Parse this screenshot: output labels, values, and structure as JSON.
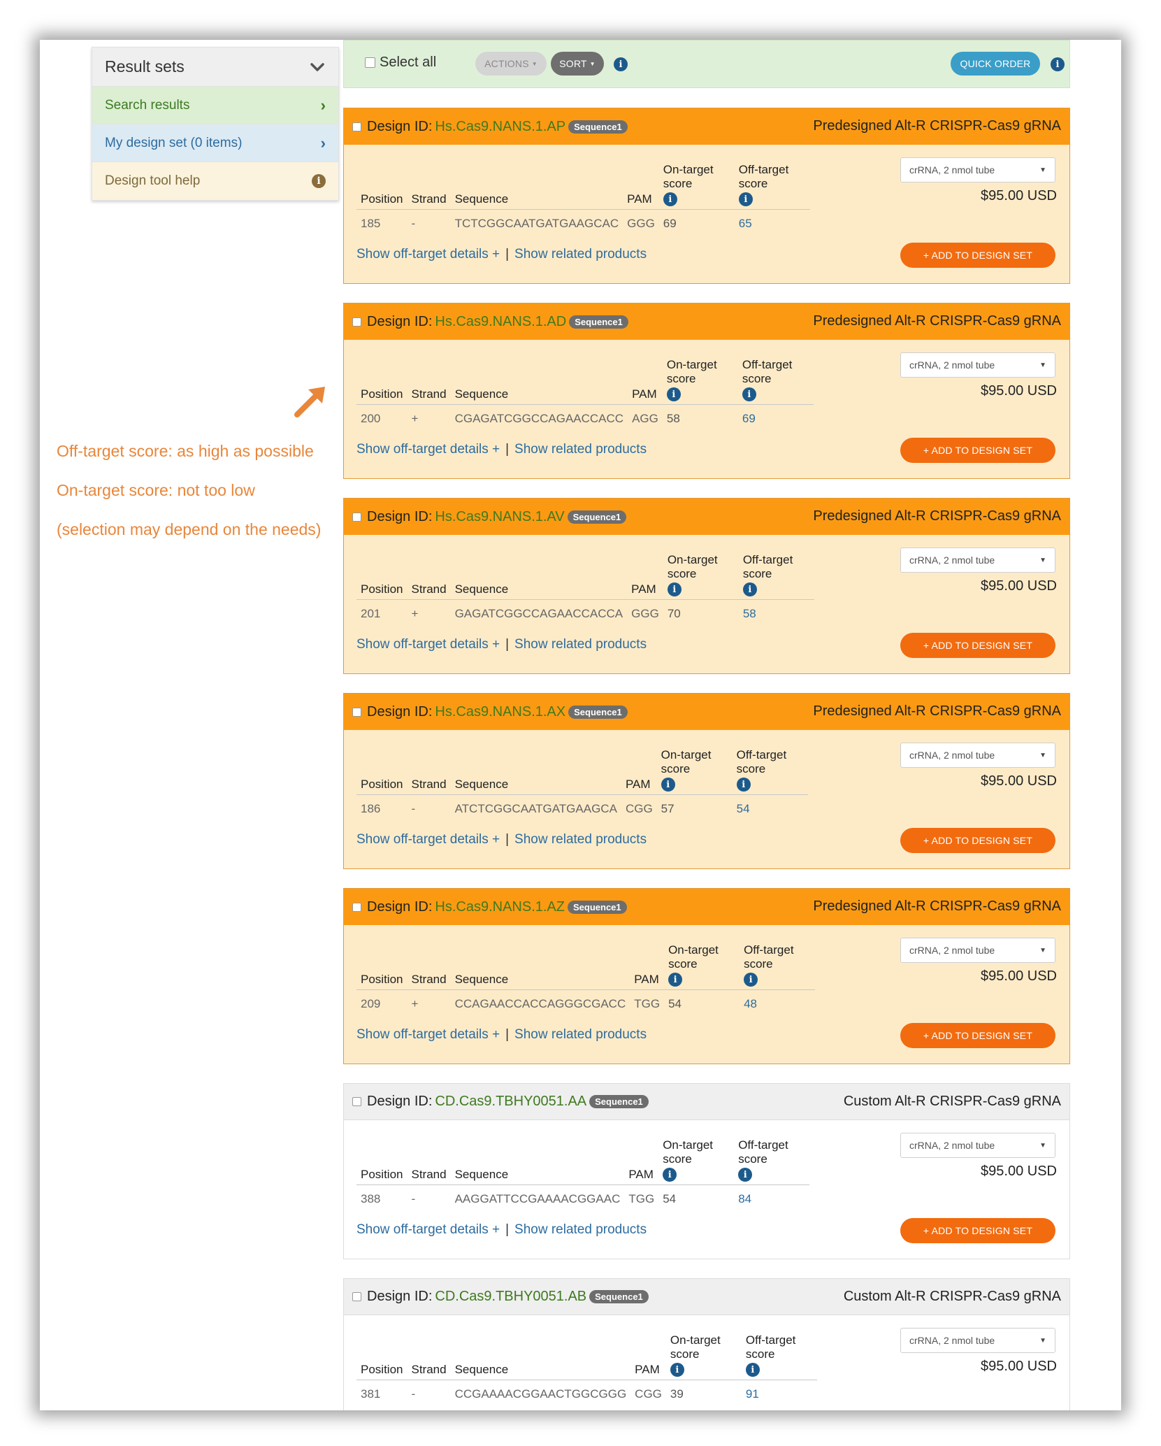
{
  "sidebar": {
    "title": "Result sets",
    "items": [
      {
        "label": "Search results"
      },
      {
        "label": "My design set (0 items)"
      },
      {
        "label": "Design tool help"
      }
    ]
  },
  "annotation": {
    "lines": [
      "Off-target score: as high as possible",
      "On-target score: not too low",
      "(selection may depend on the needs)"
    ],
    "color": "#e8863a"
  },
  "toolbar": {
    "select_all": "Select all",
    "actions": "ACTIONS",
    "sort": "SORT",
    "quick_order": "QUICK ORDER"
  },
  "columns": {
    "position": "Position",
    "strand": "Strand",
    "sequence": "Sequence",
    "pam": "PAM",
    "on_target": "On-target score",
    "off_target": "Off-target score"
  },
  "common": {
    "design_id_label": "Design ID:",
    "sequence_badge": "Sequence1",
    "show_off_target": "Show off-target details +",
    "link_sep": "|",
    "show_related": "Show related products",
    "select_value": "crRNA, 2 nmol tube",
    "price": "$95.00 USD",
    "add_button": "+ ADD TO DESIGN SET"
  },
  "colors": {
    "predesigned_header": "#fb9a12",
    "predesigned_body": "#fdebc8",
    "add_button": "#f26b0f",
    "quick_order": "#3a9ec8",
    "link": "#2d6c9f"
  },
  "designs": [
    {
      "id": "Hs.Cas9.NANS.1.AP",
      "product": "Predesigned Alt-R CRISPR-Cas9 gRNA",
      "kind": "predesigned",
      "position": "185",
      "strand": "-",
      "sequence": "TCTCGGCAATGATGAAGCAC",
      "pam": "GGG",
      "on_target": "69",
      "off_target": "65"
    },
    {
      "id": "Hs.Cas9.NANS.1.AD",
      "product": "Predesigned Alt-R CRISPR-Cas9 gRNA",
      "kind": "predesigned",
      "position": "200",
      "strand": "+",
      "sequence": "CGAGATCGGCCAGAACCACC",
      "pam": "AGG",
      "on_target": "58",
      "off_target": "69"
    },
    {
      "id": "Hs.Cas9.NANS.1.AV",
      "product": "Predesigned Alt-R CRISPR-Cas9 gRNA",
      "kind": "predesigned",
      "position": "201",
      "strand": "+",
      "sequence": "GAGATCGGCCAGAACCACCA",
      "pam": "GGG",
      "on_target": "70",
      "off_target": "58"
    },
    {
      "id": "Hs.Cas9.NANS.1.AX",
      "product": "Predesigned Alt-R CRISPR-Cas9 gRNA",
      "kind": "predesigned",
      "position": "186",
      "strand": "-",
      "sequence": "ATCTCGGCAATGATGAAGCA",
      "pam": "CGG",
      "on_target": "57",
      "off_target": "54"
    },
    {
      "id": "Hs.Cas9.NANS.1.AZ",
      "product": "Predesigned Alt-R CRISPR-Cas9 gRNA",
      "kind": "predesigned",
      "position": "209",
      "strand": "+",
      "sequence": "CCAGAACCACCAGGGCGACC",
      "pam": "TGG",
      "on_target": "54",
      "off_target": "48"
    },
    {
      "id": "CD.Cas9.TBHY0051.AA",
      "product": "Custom Alt-R CRISPR-Cas9 gRNA",
      "kind": "custom",
      "position": "388",
      "strand": "-",
      "sequence": "AAGGATTCCGAAAACGGAAC",
      "pam": "TGG",
      "on_target": "54",
      "off_target": "84"
    },
    {
      "id": "CD.Cas9.TBHY0051.AB",
      "product": "Custom Alt-R CRISPR-Cas9 gRNA",
      "kind": "custom",
      "position": "381",
      "strand": "-",
      "sequence": "CCGAAAACGGAACTGGCGGG",
      "pam": "CGG",
      "on_target": "39",
      "off_target": "91"
    }
  ]
}
